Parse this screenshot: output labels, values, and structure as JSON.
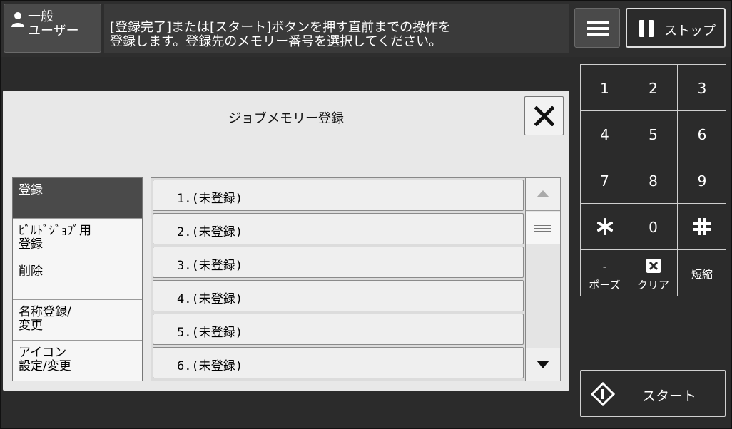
{
  "header": {
    "user_label": "一般\nユーザー",
    "message": "[登録完了]または[スタート]ボタンを押す直前までの操作を\n登録します。登録先のメモリー番号を選択してください。",
    "menu_icon": "hamburger-menu-icon",
    "stop_label": "ストップ"
  },
  "dialog": {
    "title": "ジョブメモリー登録",
    "tabs": [
      {
        "label": "登録"
      },
      {
        "label": "ﾋﾞﾙﾄﾞｼﾞｮﾌﾞ用\n登録"
      },
      {
        "label": "削除"
      },
      {
        "label": "名称登録/\n変更"
      },
      {
        "label": "アイコン\n設定/変更"
      }
    ],
    "items": [
      {
        "label": "1.(未登録)"
      },
      {
        "label": "2.(未登録)"
      },
      {
        "label": "3.(未登録)"
      },
      {
        "label": "4.(未登録)"
      },
      {
        "label": "5.(未登録)"
      },
      {
        "label": "6.(未登録)"
      }
    ]
  },
  "keypad": {
    "keys": [
      "1",
      "2",
      "3",
      "4",
      "5",
      "6",
      "7",
      "8",
      "9",
      "0"
    ],
    "pause": {
      "symbol": "-",
      "label": "ポーズ"
    },
    "clear_label": "クリア",
    "speed_dial_label": "短縮"
  },
  "start_label": "スタート",
  "colors": {
    "background": "#2b2b2b",
    "dialog": "#e8e8e8",
    "selected_tab": "#4a4a4a"
  }
}
